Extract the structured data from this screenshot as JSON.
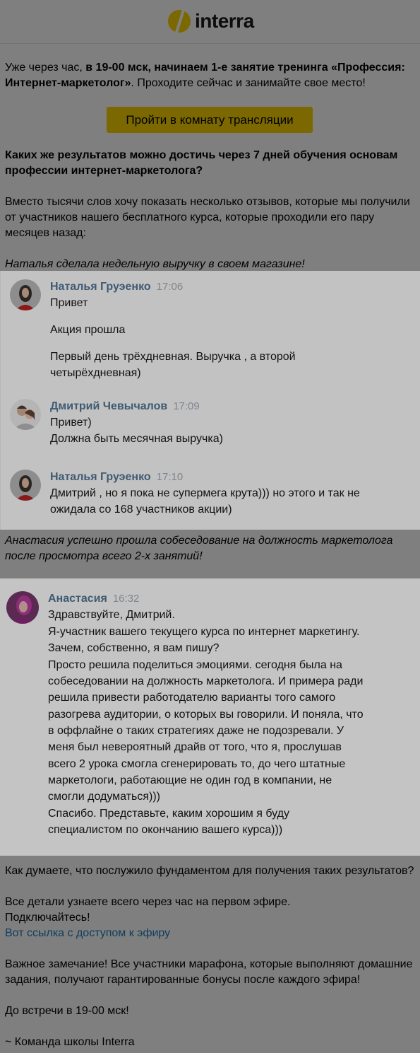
{
  "brand": {
    "name": "interra"
  },
  "intro": {
    "t1": "Уже через час, ",
    "t2": "в 19-00 мск, начинаем 1-е занятие тренинга «Профессия:",
    "t3": "Интернет-маркетолог»",
    "t4": ". Проходите сейчас и занимайте свое место!"
  },
  "cta_label": "Пройти в комнату трансляции",
  "question": {
    "l1": "Каких же результатов можно достичь через 7 дней обучения основам",
    "l2": "профессии интернет-маркетолога?"
  },
  "reviews_intro": {
    "l1": "Вместо тысячи слов хочу показать несколько отзывов, которые мы получили",
    "l2": "от участников нашего бесплатного курса, которые проходили его пару",
    "l3": "месяцев назад:"
  },
  "caption1": "Наталья сделала недельную выручку в своем магазине!",
  "chat1": [
    {
      "name": "Наталья Груэенко",
      "time": "17:06",
      "lines": [
        "Привет",
        "Акция прошла",
        "Первый день трёхдневная. Выручка , а второй",
        "четырёхдневная)"
      ]
    },
    {
      "name": "Дмитрий Чевычалов",
      "time": "17:09",
      "lines": [
        "Привет)",
        "Должна быть месячная выручка)"
      ]
    },
    {
      "name": "Наталья Груэенко",
      "time": "17:10",
      "lines": [
        "Дмитрий , но я пока не супермега крута))) но этого и так не",
        "ожидала со 168 участников акции)"
      ]
    }
  ],
  "caption2": {
    "l1": "Анастасия успешно прошла собеседование на должность маркетолога",
    "l2": "после просмотра всего 2-х занятий!"
  },
  "chat2": {
    "name": "Анастасия",
    "time": "16:32",
    "lines": [
      "Здравствуйте, Дмитрий.",
      "Я-участник вашего текущего курса по интернет маркетингу.",
      "Зачем, собственно, я вам пишу?",
      "Просто решила поделиться эмоциями. сегодня была на",
      "собеседовании на должность маркетолога. И примера ради",
      "решила привести работодателю варианты того самого",
      "разогрева аудитории, о которых вы говорили. И поняла, что",
      "в оффлайне о таких стратегиях даже не подозревали. У",
      "меня был невероятный драйв от того, что я, прослушав",
      "всего 2 урока смогла сгенерировать то, до чего штатные",
      "маркетологи, работающие не один год в компании, не",
      "смогли додуматься)))",
      "Спасибо. Представьте, каким хорошим я буду",
      "специалистом по окончанию вашего курса)))"
    ]
  },
  "outro": {
    "q": "Как думаете, что послужило фундаментом для получения таких результатов?",
    "d1": "Все детали узнаете всего через час на первом эфире.",
    "d2": "Подключайтесь!",
    "link": "Вот ссылка с доступом к эфиру",
    "n1": "Важное замечание! Все участники марафона, которые выполняют домашние",
    "n2": "задания, получают гарантированные бонусы после каждого эфира!",
    "see": "До встречи в 19-00 мск!",
    "sign": "~ Команда школы Interra"
  }
}
